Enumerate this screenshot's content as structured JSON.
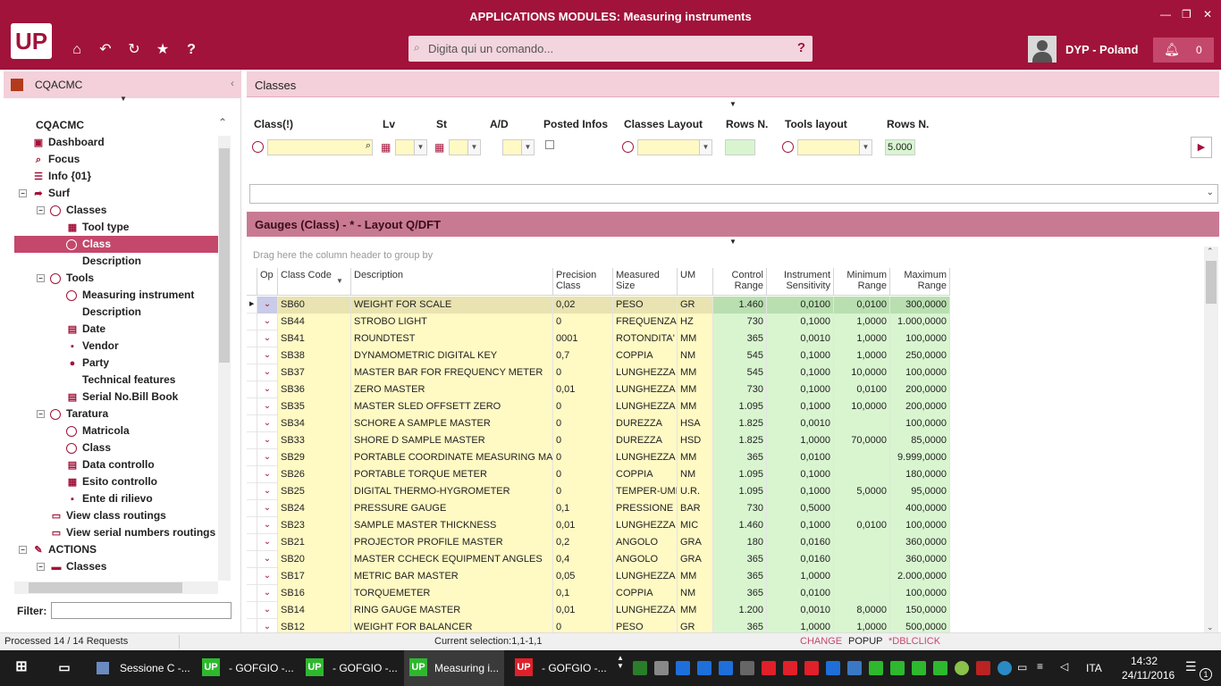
{
  "window": {
    "title": "APPLICATIONS MODULES: Measuring instruments"
  },
  "header": {
    "logo": "UP",
    "command_placeholder": "Digita qui un comando...",
    "help": "?",
    "user_label": "DYP - Poland",
    "notifications": "0"
  },
  "leftpanel": {
    "title": "CQACMC",
    "tree_title": "CQACMC",
    "filter_label": "Filter:",
    "items": [
      {
        "label": "Dashboard",
        "icon": "dashboard-icon",
        "level": 1,
        "exp": ""
      },
      {
        "label": "Focus",
        "icon": "search-icon",
        "level": 1,
        "exp": ""
      },
      {
        "label": "Info {01}",
        "icon": "list-icon",
        "level": 1,
        "exp": ""
      },
      {
        "label": "Surf",
        "icon": "arrow-icon",
        "level": 1,
        "exp": "−"
      },
      {
        "label": "Classes",
        "icon": "circle-icon",
        "level": 2,
        "exp": "−"
      },
      {
        "label": "Tool type",
        "icon": "grid-icon",
        "level": 3,
        "exp": ""
      },
      {
        "label": "Class",
        "icon": "circle-icon",
        "level": 3,
        "exp": "",
        "selected": true
      },
      {
        "label": "Description",
        "icon": "",
        "level": 3,
        "exp": ""
      },
      {
        "label": "Tools",
        "icon": "circle-icon",
        "level": 2,
        "exp": "−"
      },
      {
        "label": "Measuring instrument",
        "icon": "circle-icon",
        "level": 3,
        "exp": ""
      },
      {
        "label": "Description",
        "icon": "",
        "level": 3,
        "exp": ""
      },
      {
        "label": "Date",
        "icon": "calendar-icon",
        "level": 3,
        "exp": ""
      },
      {
        "label": "Vendor",
        "icon": "contact-icon",
        "level": 3,
        "exp": ""
      },
      {
        "label": "Party",
        "icon": "person-icon",
        "level": 3,
        "exp": ""
      },
      {
        "label": "Technical features",
        "icon": "",
        "level": 3,
        "exp": ""
      },
      {
        "label": "Serial No.Bill Book",
        "icon": "calendar-icon",
        "level": 3,
        "exp": ""
      },
      {
        "label": "Taratura",
        "icon": "circle-icon",
        "level": 2,
        "exp": "−"
      },
      {
        "label": "Matricola",
        "icon": "circle-icon",
        "level": 3,
        "exp": ""
      },
      {
        "label": "Class",
        "icon": "circle-icon",
        "level": 3,
        "exp": ""
      },
      {
        "label": "Data controllo",
        "icon": "calendar-icon",
        "level": 3,
        "exp": ""
      },
      {
        "label": "Esito controllo",
        "icon": "grid-icon",
        "level": 3,
        "exp": ""
      },
      {
        "label": "Ente di rilievo",
        "icon": "contact-icon",
        "level": 3,
        "exp": ""
      },
      {
        "label": "View class routings",
        "icon": "monitor-icon",
        "level": 2,
        "exp": ""
      },
      {
        "label": "View serial numbers routings",
        "icon": "monitor-icon",
        "level": 2,
        "exp": ""
      },
      {
        "label": "ACTIONS",
        "icon": "pencil-icon",
        "level": 1,
        "exp": "−"
      },
      {
        "label": "Classes",
        "icon": "folder-icon",
        "level": 2,
        "exp": "−"
      }
    ]
  },
  "main": {
    "tab_title": "Classes",
    "filters": {
      "class_label": "Class(!)",
      "lv_label": "Lv",
      "st_label": "St",
      "ad_label": "A/D",
      "posted_label": "Posted Infos",
      "classes_layout_label": "Classes Layout",
      "rows_label": "Rows N.",
      "tools_layout_label": "Tools layout",
      "rows2_label": "Rows N.",
      "rows2_value": "5.000"
    },
    "grid_title": "Gauges (Class) - * - Layout Q/DFT",
    "group_hint": "Drag here the column header to group by",
    "columns": [
      "Op",
      "Class Code",
      "Description",
      "Precision Class",
      "Measured Size",
      "UM",
      "Control Range",
      "Instrument Sensitivity",
      "Minimum Range",
      "Maximum Range"
    ],
    "rows": [
      [
        "SB60",
        "WEIGHT FOR SCALE",
        "0,02",
        "PESO",
        "GR",
        "1.460",
        "0,0100",
        "0,0100",
        "300,0000"
      ],
      [
        "SB44",
        "STROBO LIGHT",
        "0",
        "FREQUENZA",
        "HZ",
        "730",
        "0,1000",
        "1,0000",
        "1.000,0000"
      ],
      [
        "SB41",
        "ROUNDTEST",
        "0001",
        "ROTONDITA'",
        "MM",
        "365",
        "0,0010",
        "1,0000",
        "100,0000"
      ],
      [
        "SB38",
        "DYNAMOMETRIC DIGITAL KEY",
        "0,7",
        "COPPIA",
        "NM",
        "545",
        "0,1000",
        "1,0000",
        "250,0000"
      ],
      [
        "SB37",
        "MASTER BAR FOR FREQUENCY METER",
        "0",
        "LUNGHEZZA",
        "MM",
        "545",
        "0,1000",
        "10,0000",
        "100,0000"
      ],
      [
        "SB36",
        "ZERO MASTER",
        "0,01",
        "LUNGHEZZA",
        "MM",
        "730",
        "0,1000",
        "0,0100",
        "200,0000"
      ],
      [
        "SB35",
        "MASTER SLED OFFSETT ZERO",
        "0",
        "LUNGHEZZA",
        "MM",
        "1.095",
        "0,1000",
        "10,0000",
        "200,0000"
      ],
      [
        "SB34",
        "SCHORE A SAMPLE MASTER",
        "0",
        "DUREZZA",
        "HSA",
        "1.825",
        "0,0010",
        "",
        "100,0000"
      ],
      [
        "SB33",
        "SHORE D SAMPLE MASTER",
        "0",
        "DUREZZA",
        "HSD",
        "1.825",
        "1,0000",
        "70,0000",
        "85,0000"
      ],
      [
        "SB29",
        "PORTABLE COORDINATE MEASURING MACH.",
        "0",
        "LUNGHEZZA",
        "MM",
        "365",
        "0,0100",
        "",
        "9.999,0000"
      ],
      [
        "SB26",
        "PORTABLE TORQUE METER",
        "0",
        "COPPIA",
        "NM",
        "1.095",
        "0,1000",
        "",
        "180,0000"
      ],
      [
        "SB25",
        "DIGITAL THERMO-HYGROMETER",
        "0",
        "TEMPER-UMI",
        "U.R.",
        "1.095",
        "0,1000",
        "5,0000",
        "95,0000"
      ],
      [
        "SB24",
        "PRESSURE GAUGE",
        "0,1",
        "PRESSIONE",
        "BAR",
        "730",
        "0,5000",
        "",
        "400,0000"
      ],
      [
        "SB23",
        "SAMPLE MASTER THICKNESS",
        "0,01",
        "LUNGHEZZA",
        "MIC",
        "1.460",
        "0,1000",
        "0,0100",
        "100,0000"
      ],
      [
        "SB21",
        "PROJECTOR PROFILE MASTER",
        "0,2",
        "ANGOLO",
        "GRA",
        "180",
        "0,0160",
        "",
        "360,0000"
      ],
      [
        "SB20",
        "MASTER CCHECK EQUIPMENT ANGLES",
        "0,4",
        "ANGOLO",
        "GRA",
        "365",
        "0,0160",
        "",
        "360,0000"
      ],
      [
        "SB17",
        "METRIC BAR MASTER",
        "0,05",
        "LUNGHEZZA",
        "MM",
        "365",
        "1,0000",
        "",
        "2.000,0000"
      ],
      [
        "SB16",
        "TORQUEMETER",
        "0,1",
        "COPPIA",
        "NM",
        "365",
        "0,0100",
        "",
        "100,0000"
      ],
      [
        "SB14",
        "RING GAUGE MASTER",
        "0,01",
        "LUNGHEZZA",
        "MM",
        "1.200",
        "0,0010",
        "8,0000",
        "150,0000"
      ],
      [
        "SB12",
        "WEIGHT FOR BALANCER",
        "0",
        "PESO",
        "GR",
        "365",
        "1,0000",
        "1,0000",
        "500,0000"
      ]
    ]
  },
  "statusbar": {
    "left": "Processed 14 / 14 Requests",
    "selection": "Current selection:1,1-1,1",
    "change": "CHANGE",
    "popup": "POPUP",
    "dblclick": "*DBLCLICK"
  },
  "taskbar": {
    "tasks": [
      "Sessione C -...",
      "- GOFGIO -...",
      "- GOFGIO -...",
      "Measuring i...",
      "- GOFGIO -..."
    ],
    "lang": "ITA",
    "time": "14:32",
    "date": "24/11/2016",
    "notif_count": "1"
  },
  "colors": {
    "brand": "#a1133a",
    "accent": "#c4486b",
    "yellow_cell": "#fff9c4",
    "green_cell": "#d9f5d0"
  }
}
